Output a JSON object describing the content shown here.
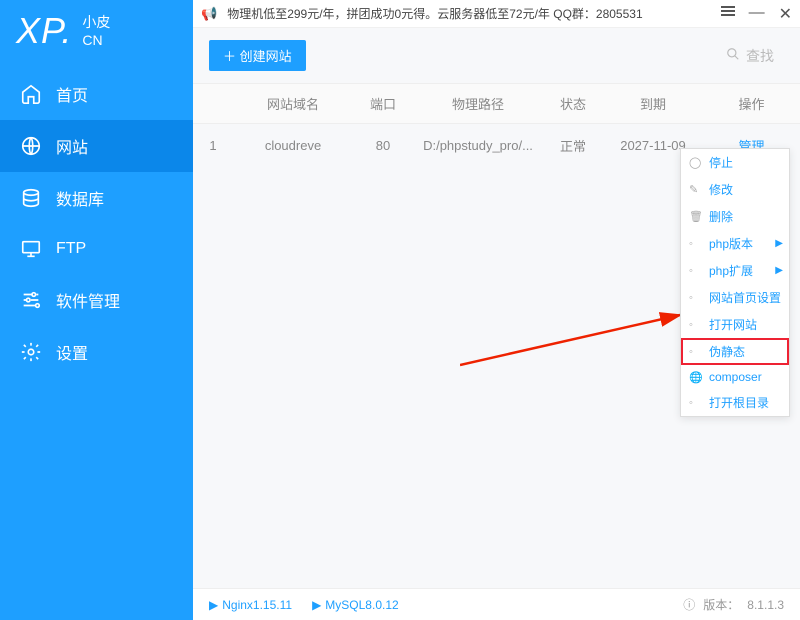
{
  "logo": {
    "xp": "XP.",
    "small1": "小皮",
    "small2": "CN"
  },
  "sidebar": {
    "items": [
      {
        "label": "首页"
      },
      {
        "label": "网站"
      },
      {
        "label": "数据库"
      },
      {
        "label": "FTP"
      },
      {
        "label": "软件管理"
      },
      {
        "label": "设置"
      }
    ]
  },
  "topbar": {
    "promo": "物理机低至299元/年，拼团成功0元得。云服务器低至72元/年  QQ群：2805531"
  },
  "toolbar": {
    "create_label": "创建网站",
    "search_label": "查找"
  },
  "table": {
    "headers": {
      "domain": "网站域名",
      "port": "端口",
      "path": "物理路径",
      "status": "状态",
      "expire": "到期",
      "action": "操作"
    },
    "rows": [
      {
        "num": "1",
        "domain": "cloudreve",
        "port": "80",
        "path": "D:/phpstudy_pro/...",
        "status": "正常",
        "expire": "2027-11-09",
        "action": "管理"
      }
    ]
  },
  "context": {
    "items": [
      {
        "label": "停止",
        "icon": "◯"
      },
      {
        "label": "修改",
        "icon": "✎"
      },
      {
        "label": "删除",
        "icon": "🗑"
      },
      {
        "label": "php版本",
        "icon": "◦",
        "submenu": true
      },
      {
        "label": "php扩展",
        "icon": "◦",
        "submenu": true
      },
      {
        "label": "网站首页设置",
        "icon": "◦"
      },
      {
        "label": "打开网站",
        "icon": "◦"
      },
      {
        "label": "伪静态",
        "icon": "◦",
        "highlight": true
      },
      {
        "label": "composer",
        "icon": "🌐"
      },
      {
        "label": "打开根目录",
        "icon": "◦"
      }
    ]
  },
  "statusbar": {
    "nginx": "Nginx1.15.11",
    "mysql": "MySQL8.0.12",
    "version_label": "版本：",
    "version": "8.1.1.3"
  }
}
